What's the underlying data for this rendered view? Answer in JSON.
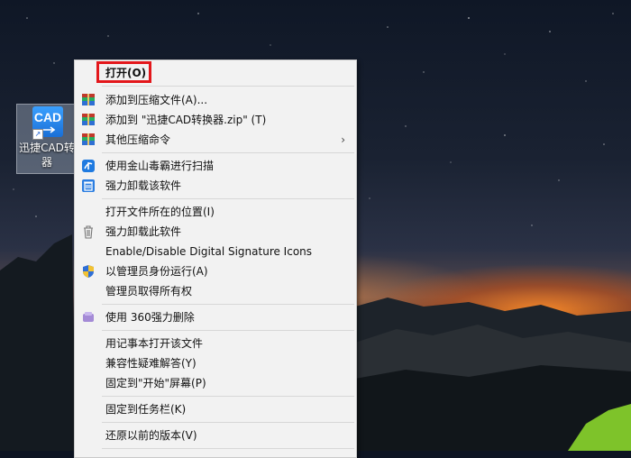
{
  "desktop": {
    "icon": {
      "tile_text": "CAD",
      "label_line1": "迅捷CAD转",
      "label_line2": "器"
    }
  },
  "context_menu": {
    "items": [
      {
        "id": "open",
        "label": "打开(O)"
      },
      {
        "id": "add-archive",
        "label": "添加到压缩文件(A)..."
      },
      {
        "id": "add-zip",
        "label": "添加到 \"迅捷CAD转换器.zip\" (T)"
      },
      {
        "id": "other-compress",
        "label": "其他压缩命令"
      },
      {
        "id": "kingsoft-scan",
        "label": "使用金山毒霸进行扫描"
      },
      {
        "id": "force-uninstall-app",
        "label": "强力卸载该软件"
      },
      {
        "id": "open-location",
        "label": "打开文件所在的位置(I)"
      },
      {
        "id": "force-uninstall-this",
        "label": "强力卸载此软件"
      },
      {
        "id": "signature-icons",
        "label": "Enable/Disable Digital Signature Icons"
      },
      {
        "id": "run-as-admin",
        "label": "以管理员身份运行(A)"
      },
      {
        "id": "take-ownership",
        "label": "管理员取得所有权"
      },
      {
        "id": "360-delete",
        "label": "使用 360强力删除"
      },
      {
        "id": "notepad-open",
        "label": "用记事本打开该文件"
      },
      {
        "id": "compat-troubleshoot",
        "label": "兼容性疑难解答(Y)"
      },
      {
        "id": "pin-start",
        "label": "固定到\"开始\"屏幕(P)"
      },
      {
        "id": "pin-taskbar",
        "label": "固定到任务栏(K)"
      },
      {
        "id": "restore-previous",
        "label": "还原以前的版本(V)"
      }
    ],
    "submenu_arrow": "›"
  },
  "colors": {
    "highlight": "#e3171b",
    "menu_bg": "#f2f2f2"
  }
}
